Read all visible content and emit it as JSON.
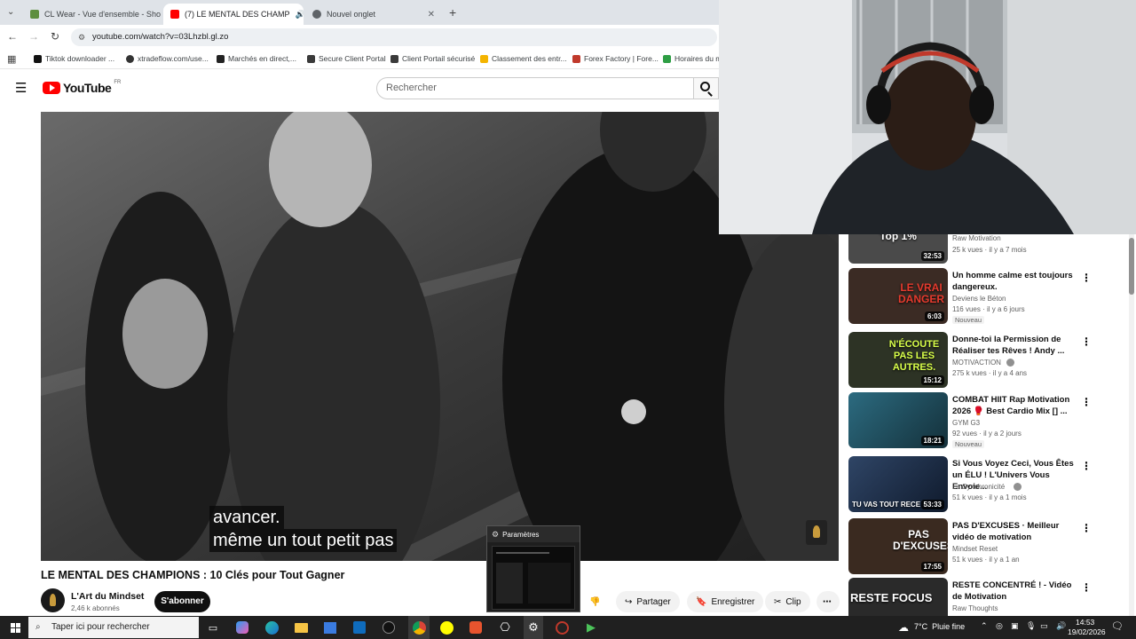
{
  "tabs": [
    {
      "label": "CL Wear - Vue d'ensemble - Sho",
      "active": false
    },
    {
      "label": "(7) LE MENTAL DES CHAMP",
      "active": true
    },
    {
      "label": "Nouvel onglet",
      "active": false
    }
  ],
  "address": {
    "url": "youtube.com/watch?v=03Lhzbl.gl.zo"
  },
  "bookmarks": [
    "Tiktok downloader ...",
    "xtradeflow.com/use...",
    "Marchés en direct,...",
    "Secure Client Portal",
    "Client Portail sécurisé",
    "Classement des entr...",
    "Forex Factory | Fore...",
    "Horaires du m"
  ],
  "youtube": {
    "logo_text": "YouTube",
    "logo_region": "FR",
    "search_placeholder": "Rechercher"
  },
  "player": {
    "caption_line1": "avancer.",
    "caption_line2": "même un tout petit pas"
  },
  "video": {
    "title": "LE MENTAL DES CHAMPIONS : 10 Clés pour Tout Gagner",
    "channel": "L'Art du Mindset",
    "subscribers": "2,46 k abonnés",
    "subscribe_label": "S'abonner",
    "share_label": "Partager",
    "save_label": "Enregistrer",
    "clip_label": "Clip"
  },
  "settings_popup": {
    "title": "Paramètres"
  },
  "recommendations": [
    {
      "title": "",
      "channel": "Raw Motivation",
      "meta": "25 k vues · il y a 7 mois",
      "duration": "32:53",
      "badge": "",
      "thumb_text": "Top 1%",
      "thumb_color": "#4a4a4a"
    },
    {
      "title": "Un homme calme est toujours dangereux.",
      "channel": "Deviens le Béton",
      "meta": "116 vues · il y a 6 jours",
      "duration": "6:03",
      "badge": "Nouveau",
      "thumb_text": "LE VRAI DANGER",
      "thumb_color": "#3b2b24"
    },
    {
      "title": "Donne-toi la Permission de Réaliser tes Rêves ! Andy ...",
      "channel": "MOTIVACTION",
      "meta": "275 k vues · il y a 4 ans",
      "duration": "15:12",
      "badge": "",
      "thumb_text": "N'ÉCOUTE PAS LES AUTRES.",
      "thumb_color": "#2d3325"
    },
    {
      "title": "COMBAT HIIT Rap Motivation 2026 🥊 Best Cardio Mix [] ...",
      "channel": "GYM G3",
      "meta": "92 vues · il y a 2 jours",
      "duration": "18:21",
      "badge": "Nouveau",
      "thumb_text": "",
      "thumb_color": "#1f4a5a"
    },
    {
      "title": "Si Vous Voyez Ceci, Vous Êtes un ÉLU ! L'Univers Vous Envoie...",
      "channel": "La Synchronicité",
      "meta": "51 k vues · il y a 1 mois",
      "duration": "53:33",
      "badge": "",
      "thumb_text": "TU VAS TOUT RECE",
      "thumb_color": "#23304a"
    },
    {
      "title": "PAS D'EXCUSES · Meilleur vidéo de motivation",
      "channel": "Mindset Reset",
      "meta": "51 k vues · il y a 1 an",
      "duration": "17:55",
      "badge": "",
      "thumb_text": "PAS D'EXCUSES",
      "thumb_color": "#3a2a20"
    },
    {
      "title": "RESTE CONCENTRÉ ! - Vidéo de Motivation",
      "channel": "Raw Thoughts",
      "meta": "",
      "duration": "",
      "badge": "",
      "thumb_text": "RESTE FOCUS",
      "thumb_color": "#2a2a2a"
    }
  ],
  "taskbar": {
    "search_placeholder": "Taper ici pour rechercher",
    "weather": "7°C  Pluie fine",
    "time": "14:53",
    "date": "19/02/2026"
  },
  "colors": {
    "youtube_red": "#ff0000",
    "taskbar": "#202020",
    "tab_strip": "#dfe3e8"
  }
}
